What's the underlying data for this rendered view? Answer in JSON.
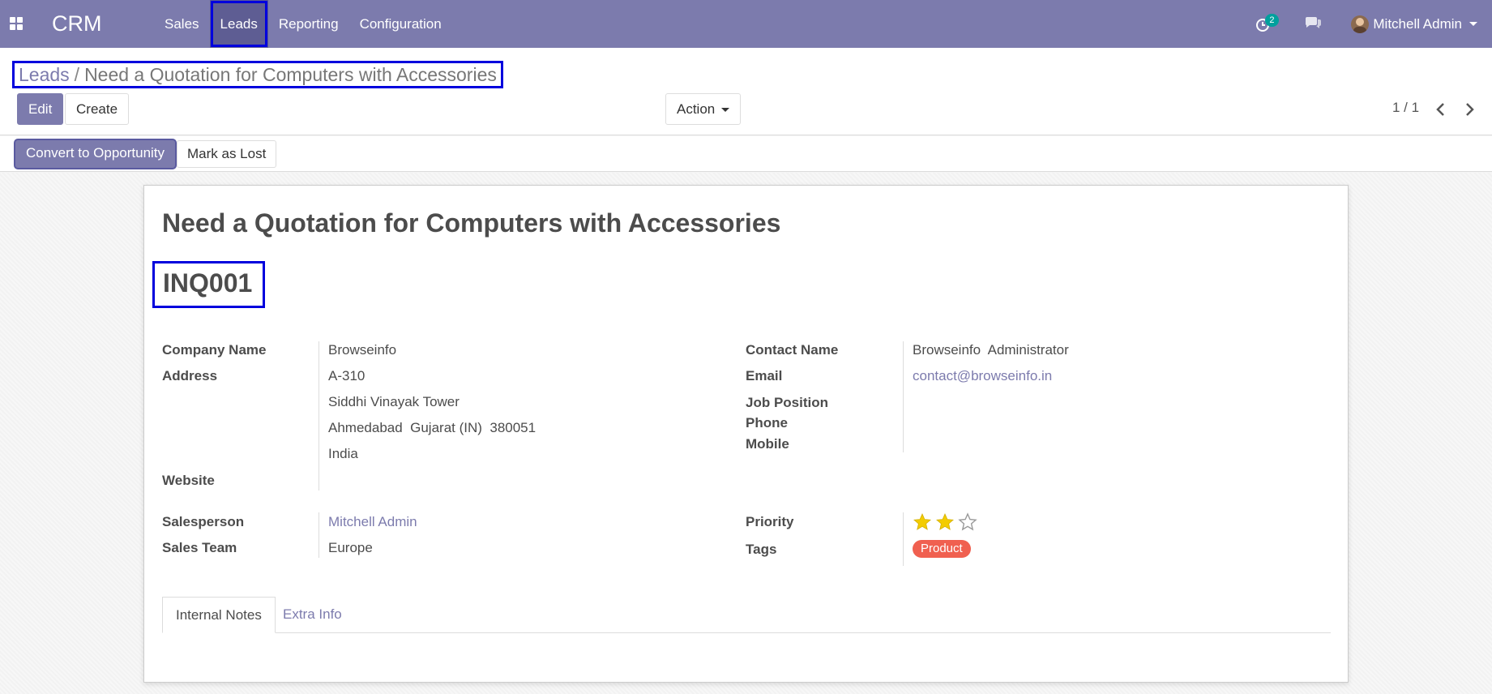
{
  "navbar": {
    "brand": "CRM",
    "menu": [
      "Sales",
      "Leads",
      "Reporting",
      "Configuration"
    ],
    "activity_count": "2",
    "user_name": "Mitchell Admin"
  },
  "breadcrumb": {
    "parent": "Leads",
    "separator": "/",
    "current": "Need a Quotation for Computers with Accessories"
  },
  "toolbar": {
    "edit_label": "Edit",
    "create_label": "Create",
    "action_label": "Action",
    "pager": "1 / 1"
  },
  "statusbar": {
    "convert_label": "Convert to Opportunity",
    "lost_label": "Mark as Lost"
  },
  "lead": {
    "title": "Need a Quotation for Computers with Accessories",
    "reference": "INQ001",
    "labels": {
      "company_name": "Company Name",
      "address": "Address",
      "website": "Website",
      "contact_name": "Contact Name",
      "email": "Email",
      "job_position": "Job Position",
      "phone": "Phone",
      "mobile": "Mobile",
      "salesperson": "Salesperson",
      "sales_team": "Sales Team",
      "priority": "Priority",
      "tags": "Tags"
    },
    "company_name": "Browseinfo",
    "address_lines": [
      "A-310",
      "Siddhi Vinayak Tower",
      "Ahmedabad  Gujarat (IN)  380051",
      "India"
    ],
    "contact_name": "Browseinfo  Administrator",
    "email": "contact@browseinfo.in",
    "salesperson": "Mitchell Admin",
    "sales_team": "Europe",
    "priority": {
      "value": 2,
      "max": 3,
      "color": "#f3cc00"
    },
    "tags": [
      "Product"
    ],
    "tag_color": "#f06050"
  },
  "tabs": [
    "Internal Notes",
    "Extra Info"
  ],
  "colors": {
    "primary": "#7c7bad",
    "highlight": "#0000dd",
    "badge": "#00a09d"
  }
}
